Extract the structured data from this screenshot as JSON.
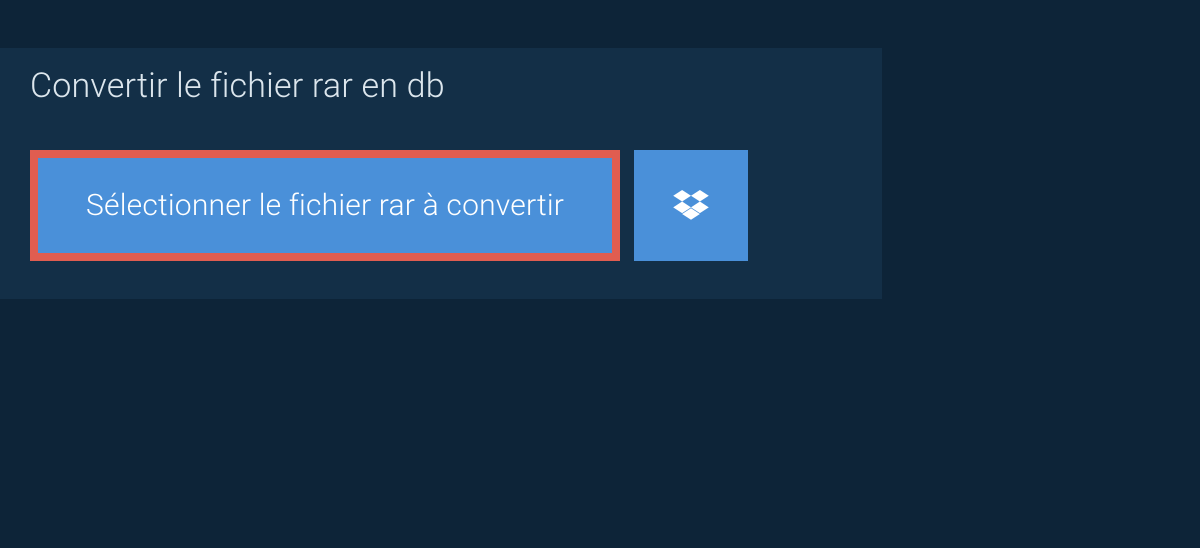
{
  "panel": {
    "title": "Convertir le fichier rar en db",
    "select_button_label": "Sélectionner le fichier rar à convertir"
  }
}
